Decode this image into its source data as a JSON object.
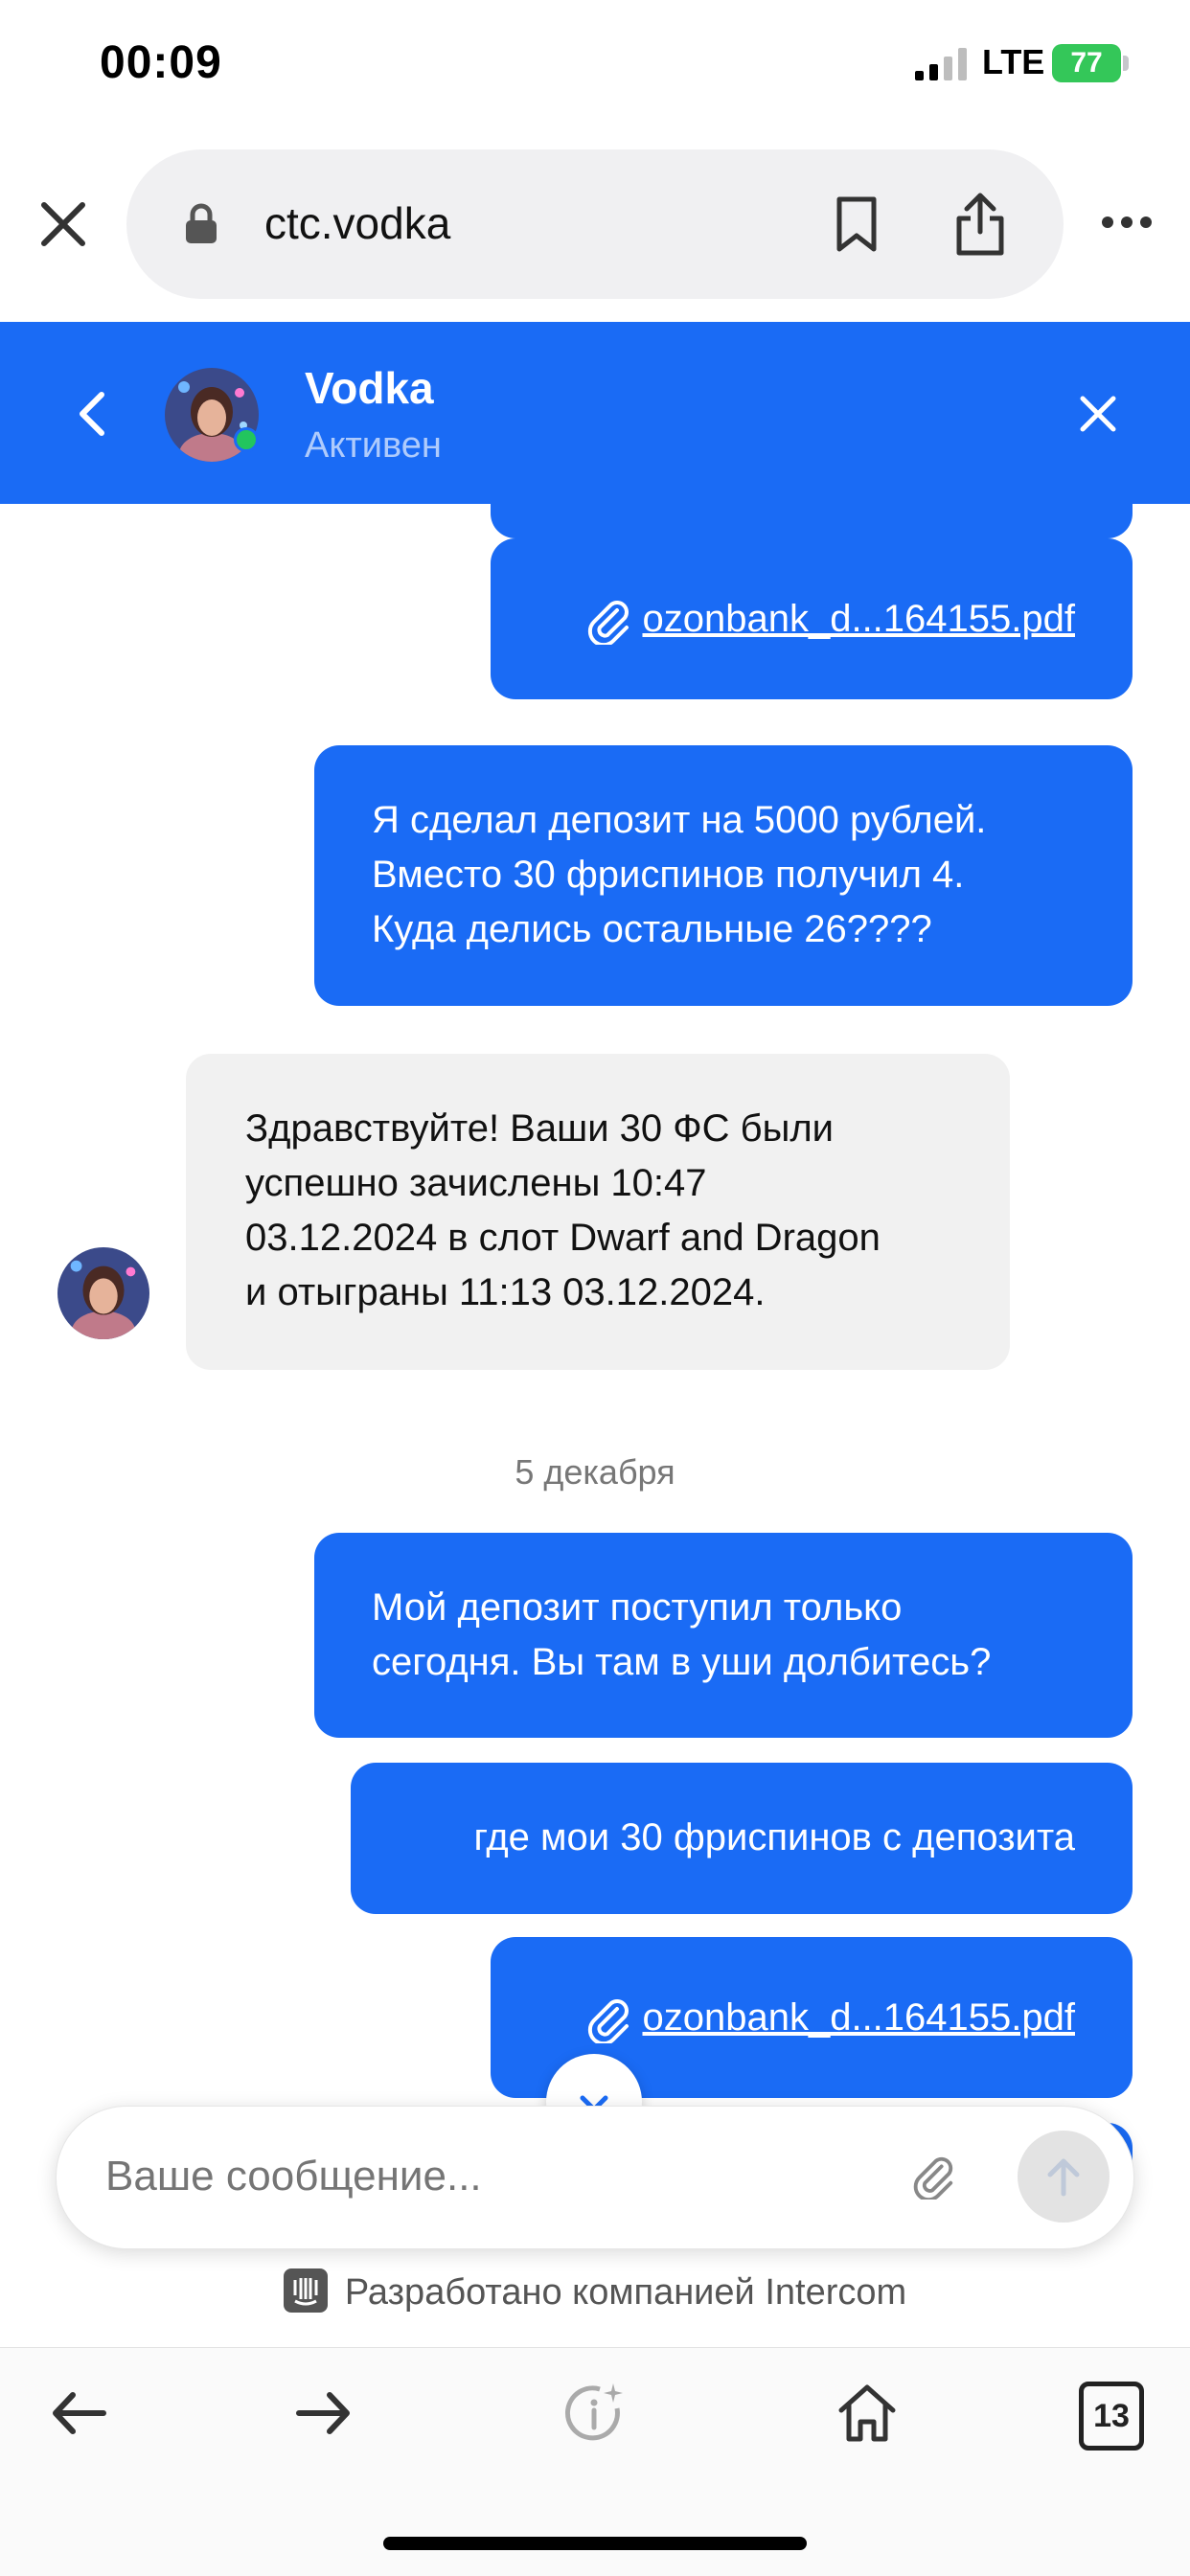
{
  "status_bar": {
    "time": "00:09",
    "network": "LTE",
    "battery": "77"
  },
  "browser": {
    "url": "ctc.vodka",
    "tab_count": "13"
  },
  "chat_header": {
    "name": "Vodka",
    "status": "Активен"
  },
  "messages": [
    {
      "from": "user",
      "type": "file",
      "text": "ozonbank_d...164155.pdf"
    },
    {
      "from": "user",
      "type": "text",
      "lines": [
        "Я сделал депозит на 5000 рублей.",
        "Вместо 30 фриспинов получил 4.",
        "Куда делись остальные 26????"
      ]
    },
    {
      "from": "agent",
      "type": "text",
      "lines": [
        "Здравствуйте! Ваши 30 ФС были",
        "успешно зачислены 10:47",
        "03.12.2024 в слот Dwarf and Dragon",
        "и отыграны 11:13 03.12.2024."
      ]
    },
    {
      "type": "date",
      "text": "5 декабря"
    },
    {
      "from": "user",
      "type": "text",
      "lines": [
        "Мой депозит поступил только",
        "сегодня. Вы там в уши долбитесь?"
      ]
    },
    {
      "from": "user",
      "type": "text",
      "lines": [
        "где мои 30 фриспинов с депозита"
      ]
    },
    {
      "from": "user",
      "type": "file",
      "text": "ozonbank_d...164155.pdf"
    }
  ],
  "composer": {
    "placeholder": "Ваше сообщение..."
  },
  "footer": {
    "powered_by": "Разработано компанией Intercom"
  },
  "colors": {
    "brand_blue": "#1a6bf5",
    "agent_bubble": "#f1f1f1",
    "battery_green": "#34c759"
  }
}
